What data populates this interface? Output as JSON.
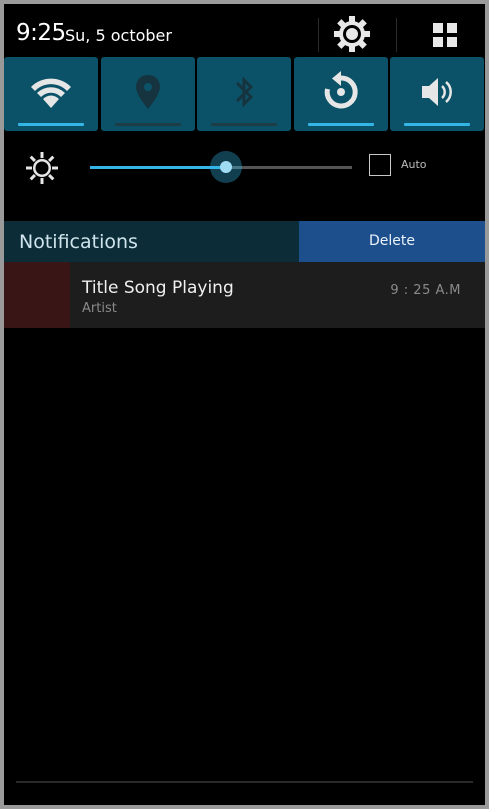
{
  "status_bar": {
    "time": "9:25",
    "date": "Su, 5 october",
    "settings_icon": "gear-icon",
    "all_settings_icon": "grid-icon"
  },
  "quick_tiles": [
    {
      "name": "wifi",
      "icon": "wifi-icon",
      "enabled": true
    },
    {
      "name": "location",
      "icon": "location-pin-icon",
      "enabled": false
    },
    {
      "name": "bluetooth",
      "icon": "bluetooth-icon",
      "enabled": false
    },
    {
      "name": "auto-rotate",
      "icon": "rotate-icon",
      "enabled": true
    },
    {
      "name": "sound",
      "icon": "speaker-icon",
      "enabled": true
    }
  ],
  "brightness": {
    "icon": "brightness-sun-icon",
    "level": 0.52,
    "auto_checked": false,
    "auto_label": "Auto"
  },
  "notifications": {
    "header_label": "Notifications",
    "delete_label": "Delete",
    "items": [
      {
        "title": "Title Song Playing",
        "subtitle": "Artist",
        "time": "9 : 25 A.M"
      }
    ]
  },
  "colors": {
    "accent": "#33b5e5",
    "tile_bg": "#0b5268",
    "header_bg": "#0c2d38",
    "delete_bg": "#1d4f8c",
    "album_art": "#3a1515"
  }
}
